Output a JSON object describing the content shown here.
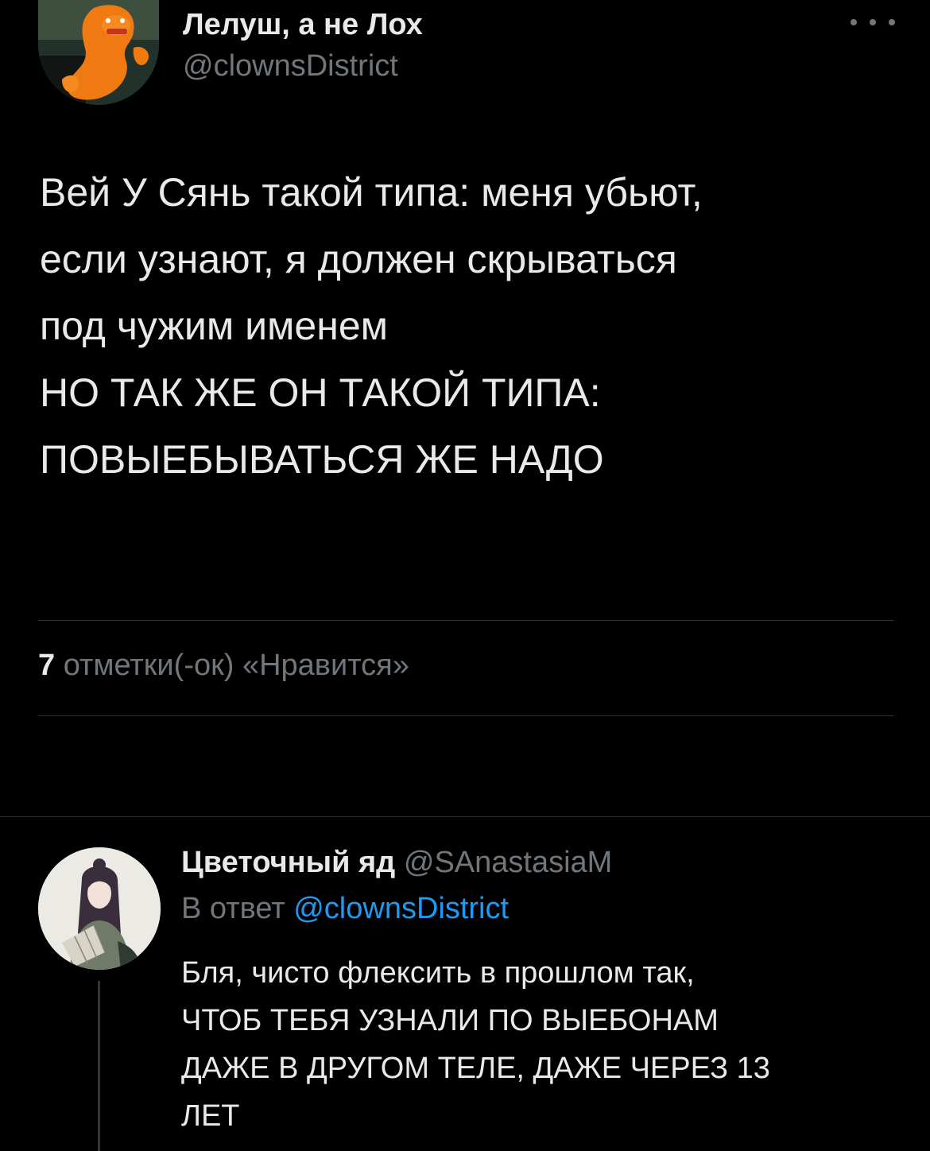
{
  "main_tweet": {
    "display_name": "Лелуш, а не Лох",
    "handle": "@clownsDistrict",
    "more_icon": "more-horizontal-icon",
    "text_lines": [
      "Вей У Сянь такой типа: меня убьют,",
      "если узнают, я должен скрываться",
      "под чужим именем",
      "НО ТАК ЖЕ ОН ТАКОЙ ТИПА:",
      "ПОВЫЕБЫВАТЬСЯ ЖЕ НАДО"
    ],
    "likes": {
      "count": "7",
      "label": "отметки(-ок) «Нравится»"
    }
  },
  "reply": {
    "display_name": "Цветочный яд",
    "handle": "@SAnastasiaM",
    "reply_to_label": "В ответ",
    "reply_to_handle": "@clownsDistrict",
    "text_lines": [
      "Бля, чисто флексить в прошлом так,",
      "ЧТОБ ТЕБЯ УЗНАЛИ ПО ВЫЕБОНАМ",
      "ДАЖЕ В ДРУГОМ ТЕЛЕ, ДАЖЕ ЧЕРЕЗ 13",
      "ЛЕТ"
    ]
  },
  "colors": {
    "background": "#000000",
    "text": "#e7e9ea",
    "secondary": "#71767b",
    "link": "#1d9bf0",
    "divider": "#2f3336"
  }
}
